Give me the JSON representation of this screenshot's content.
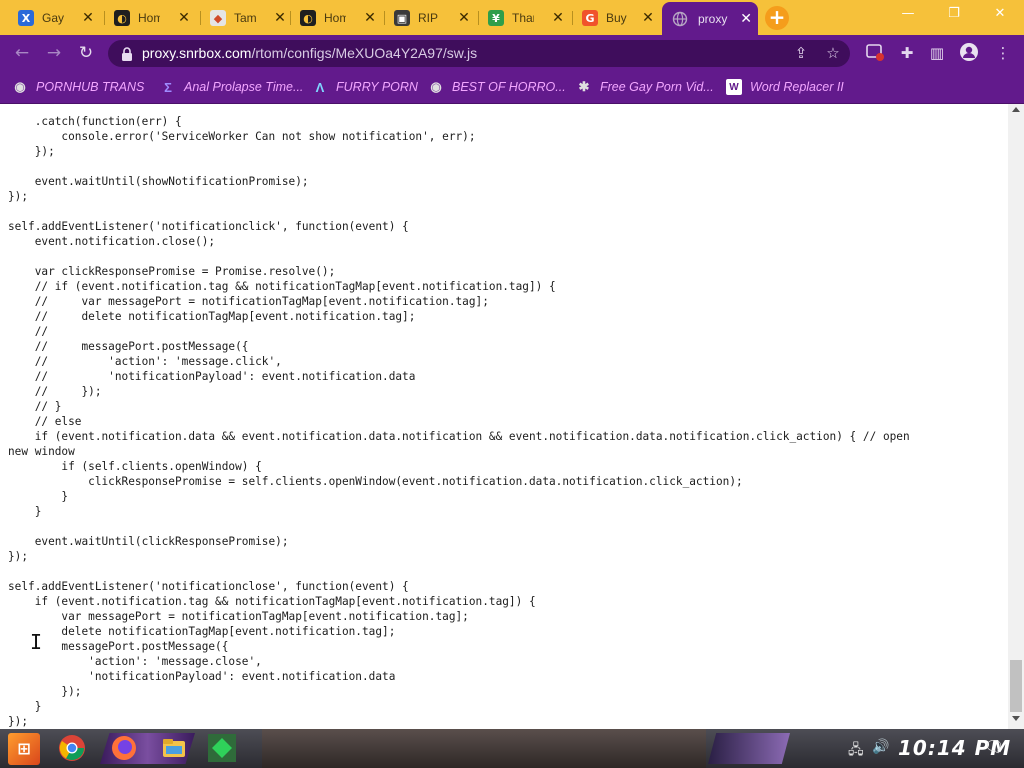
{
  "browser": {
    "tabs": [
      {
        "label": "Gay P",
        "icon": "x-logo-icon",
        "color": "#2a6ad9",
        "glyph": "X"
      },
      {
        "label": "Home",
        "icon": "discord-like-icon",
        "color": "#1f1f1f",
        "glyph": "◐"
      },
      {
        "label": "Tamp",
        "icon": "chrome-store-icon",
        "color": "#e5e5e5",
        "glyph": "◆"
      },
      {
        "label": "Home",
        "icon": "discord-like-icon",
        "color": "#1f1f1f",
        "glyph": "◐"
      },
      {
        "label": "RIP",
        "icon": "http-icon",
        "color": "#3a3a3a",
        "glyph": "▣"
      },
      {
        "label": "Than",
        "icon": "chevron-down-logo-icon",
        "color": "#2f9e4a",
        "glyph": "¥"
      },
      {
        "label": "Buy",
        "icon": "g-logo-icon",
        "color": "#f0532b",
        "glyph": "G"
      }
    ],
    "active_tab": {
      "label": "proxy",
      "icon": "globe-icon"
    },
    "new_tab_label": "+",
    "window_controls": {
      "minimize": "—",
      "restore": "❐",
      "close": "✕"
    },
    "url": {
      "host": "proxy.snrbox.com",
      "path": "/rtom/configs/MeXUOa4Y2A97/sw.js"
    },
    "bookmarks": [
      {
        "label": "PORNHUB TRANS",
        "icon": "globe-icon",
        "glyph": "◉"
      },
      {
        "label": "Anal Prolapse Time...",
        "icon": "sigma-icon",
        "glyph": "Σ"
      },
      {
        "label": "FURRY PORN",
        "icon": "lambda-icon",
        "glyph": "Λ"
      },
      {
        "label": "BEST OF HORRO...",
        "icon": "globe-icon",
        "glyph": "◉"
      },
      {
        "label": "Free Gay Porn Vid...",
        "icon": "figure-icon",
        "glyph": "✱"
      },
      {
        "label": "Word Replacer II",
        "icon": "wr-icon",
        "glyph": "W"
      }
    ]
  },
  "page": {
    "code_lines": [
      "    .catch(function(err) {",
      "        console.error('ServiceWorker Can not show notification', err);",
      "    });",
      "",
      "    event.waitUntil(showNotificationPromise);",
      "});",
      "",
      "self.addEventListener('notificationclick', function(event) {",
      "    event.notification.close();",
      "",
      "    var clickResponsePromise = Promise.resolve();",
      "    // if (event.notification.tag && notificationTagMap[event.notification.tag]) {",
      "    //     var messagePort = notificationTagMap[event.notification.tag];",
      "    //     delete notificationTagMap[event.notification.tag];",
      "    //",
      "    //     messagePort.postMessage({",
      "    //         'action': 'message.click',",
      "    //         'notificationPayload': event.notification.data",
      "    //     });",
      "    // }",
      "    // else",
      "    if (event.notification.data && event.notification.data.notification && event.notification.data.notification.click_action) { // open",
      "new window",
      "        if (self.clients.openWindow) {",
      "            clickResponsePromise = self.clients.openWindow(event.notification.data.notification.click_action);",
      "        }",
      "    }",
      "",
      "    event.waitUntil(clickResponsePromise);",
      "});",
      "",
      "self.addEventListener('notificationclose', function(event) {",
      "    if (event.notification.tag && notificationTagMap[event.notification.tag]) {",
      "        var messagePort = notificationTagMap[event.notification.tag];",
      "        delete notificationTagMap[event.notification.tag];",
      "        messagePort.postMessage({",
      "            'action': 'message.close',",
      "            'notificationPayload': event.notification.data",
      "        });",
      "    }",
      "});"
    ]
  },
  "taskbar": {
    "clock": "10:14 PM",
    "start_label": "⊞"
  },
  "colors": {
    "theme_purple": "#621a8c",
    "tabstrip_yellow": "#f6c13a",
    "bookmark_pink": "#f2a6ff"
  }
}
